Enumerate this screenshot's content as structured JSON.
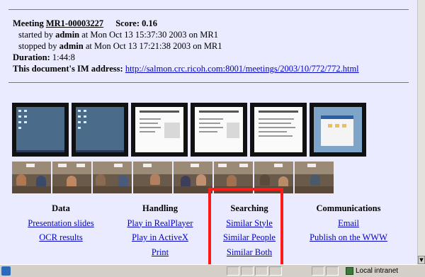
{
  "meeting": {
    "label": "Meeting",
    "id": "MR1-00003227",
    "score_label": "Score: 0.16",
    "started_prefix": "started by",
    "started_user": "admin",
    "started_rest": "at Mon Oct 13 15:37:30 2003 on MR1",
    "stopped_prefix": "stopped by",
    "stopped_user": "admin",
    "stopped_rest": "at Mon Oct 13 17:21:38 2003 on MR1",
    "duration_label": "Duration:",
    "duration_value": "1:44:8",
    "address_label": "This document's IM address:",
    "address_url": "http://salmon.crc.ricoh.com:8001/meetings/2003/10/772/772.html"
  },
  "columns": {
    "data": {
      "heading": "Data",
      "links": [
        "Presentation slides",
        "OCR results"
      ]
    },
    "handling": {
      "heading": "Handling",
      "links": [
        "Play in RealPlayer",
        "Play in ActiveX",
        "Print"
      ]
    },
    "searching": {
      "heading": "Searching",
      "links": [
        "Similar Style",
        "Similar People",
        "Similar Both"
      ]
    },
    "communications": {
      "heading": "Communications",
      "links": [
        "Email",
        "Publish on the WWW"
      ]
    }
  },
  "status_bar": {
    "zone_label": "Local intranet"
  },
  "colors": {
    "page_bg": "#ebebff",
    "link": "#0000cc",
    "highlight": "#ff1a1a"
  }
}
